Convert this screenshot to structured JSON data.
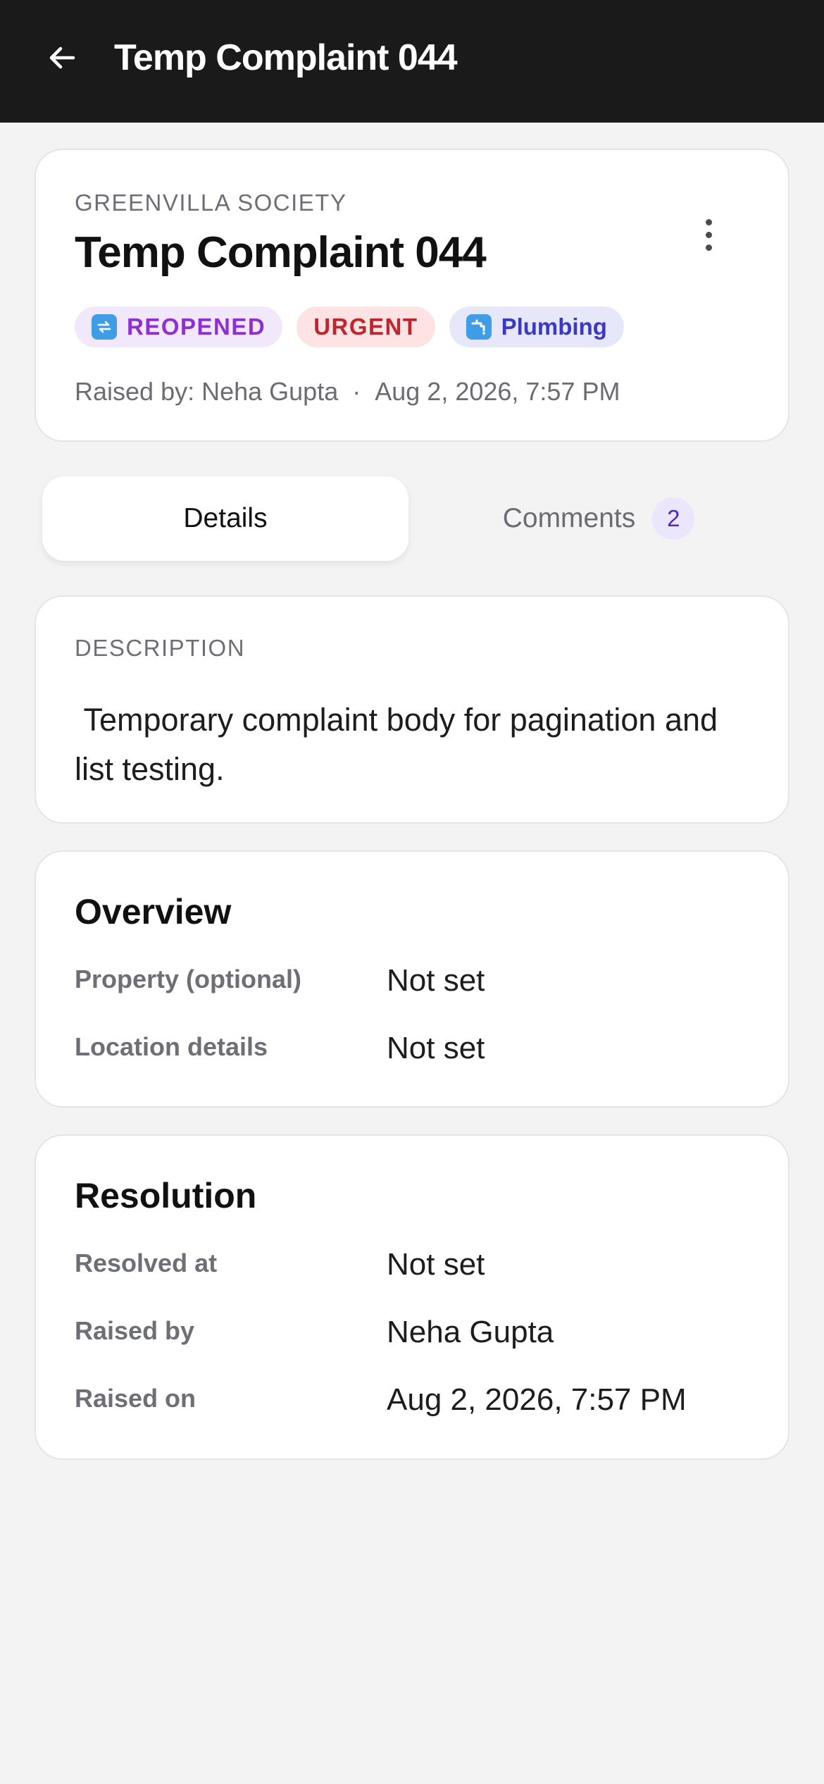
{
  "appbar": {
    "back_icon": "arrow-left-icon",
    "title": "Temp Complaint 044"
  },
  "complaint": {
    "society": "GREENVILLA SOCIETY",
    "title": "Temp Complaint 044",
    "more_icon": "more-vertical-icon",
    "chips": {
      "status": {
        "label": "REOPENED",
        "icon": "reopen-icon",
        "color": "#8f2fcf"
      },
      "priority": {
        "label": "URGENT",
        "color": "#c0242c"
      },
      "category": {
        "label": "Plumbing",
        "icon": "faucet-icon",
        "color": "#3b38c8"
      }
    },
    "raised_by_text": "Raised by: Neha Gupta",
    "separator": "·",
    "raised_at": "Aug 2, 2026, 7:57 PM"
  },
  "tabs": {
    "details": "Details",
    "comments": "Comments",
    "comments_count": "2",
    "active": "details"
  },
  "description": {
    "label": "DESCRIPTION",
    "text": " Temporary complaint body for pagination and list testing."
  },
  "overview": {
    "heading": "Overview",
    "rows": [
      {
        "label": "Property (optional)",
        "value": "Not set"
      },
      {
        "label": "Location details",
        "value": "Not set"
      }
    ]
  },
  "resolution": {
    "heading": "Resolution",
    "rows": [
      {
        "label": "Resolved at",
        "value": "Not set"
      },
      {
        "label": "Raised by",
        "value": "Neha Gupta"
      },
      {
        "label": "Raised on",
        "value": "Aug 2, 2026, 7:57 PM"
      }
    ]
  },
  "colors": {
    "appbar_bg": "#1a1a1a",
    "page_bg": "#f3f3f4",
    "accent": "#4a2fb5"
  }
}
